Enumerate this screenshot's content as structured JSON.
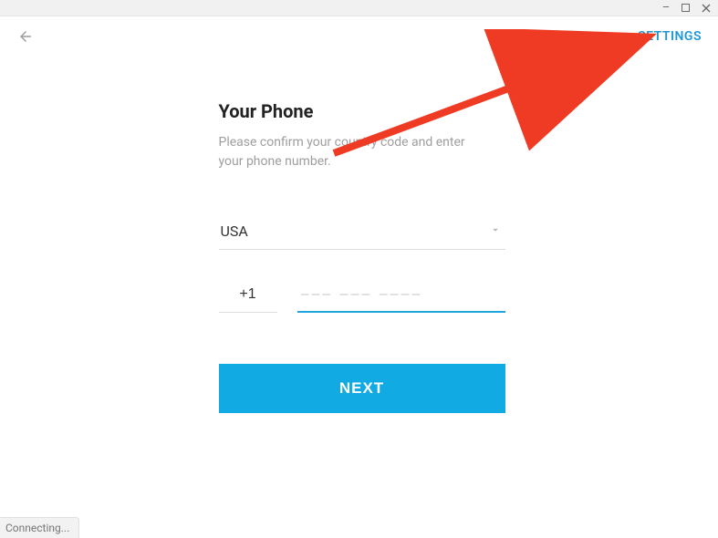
{
  "window": {
    "minimize": "–",
    "maximize": "▢",
    "close": "✕"
  },
  "topbar": {
    "settings_label": "SETTINGS"
  },
  "page": {
    "heading": "Your Phone",
    "subtext": "Please confirm your country code and enter your phone number."
  },
  "country": {
    "selected": "USA"
  },
  "phone": {
    "code_value": "+1",
    "number_value": "",
    "number_placeholder": "––– ––– ––––"
  },
  "actions": {
    "next_label": "NEXT"
  },
  "status": {
    "connecting": "Connecting..."
  }
}
